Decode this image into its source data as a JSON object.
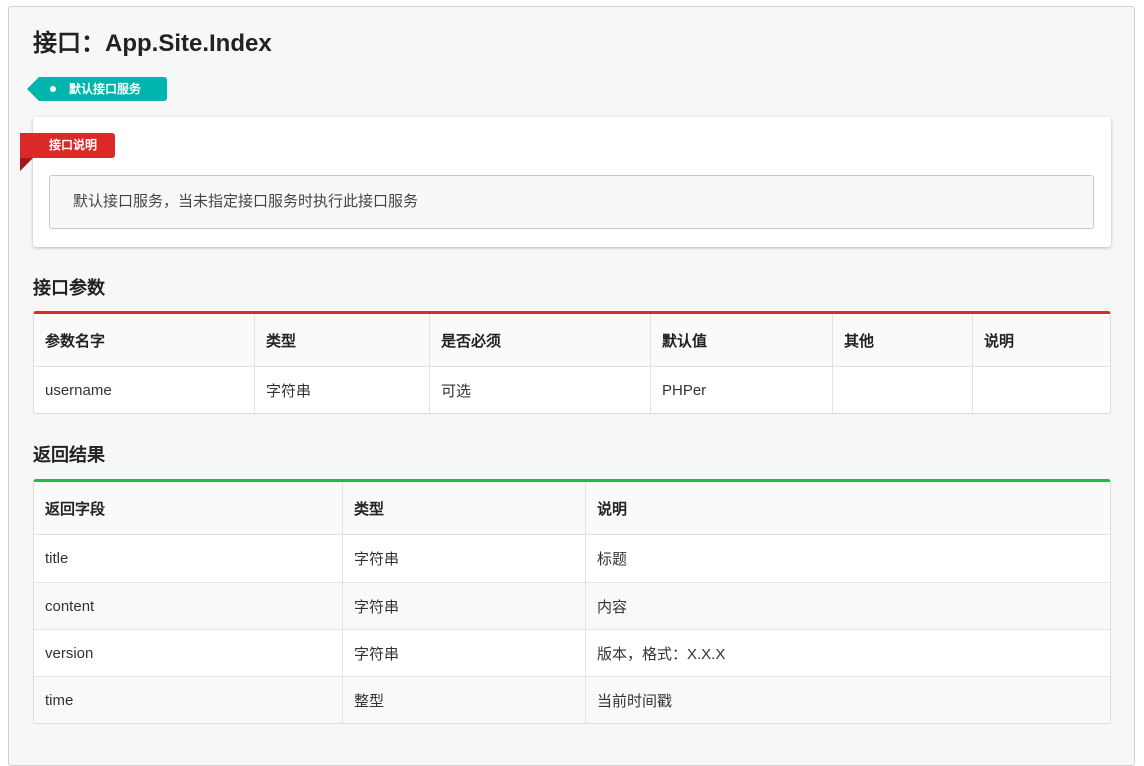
{
  "title": "接口：App.Site.Index",
  "tag": "默认接口服务",
  "ribbon": "接口说明",
  "description": "默认接口服务，当未指定接口服务时执行此接口服务",
  "params": {
    "heading": "接口参数",
    "headers": [
      "参数名字",
      "类型",
      "是否必须",
      "默认值",
      "其他",
      "说明"
    ],
    "rows": [
      [
        "username",
        "字符串",
        "可选",
        "PHPer",
        "",
        ""
      ]
    ]
  },
  "result": {
    "heading": "返回结果",
    "headers": [
      "返回字段",
      "类型",
      "说明"
    ],
    "rows": [
      [
        "title",
        "字符串",
        "标题"
      ],
      [
        "content",
        "字符串",
        "内容"
      ],
      [
        "version",
        "字符串",
        "版本，格式：X.X.X"
      ],
      [
        "time",
        "整型",
        "当前时间戳"
      ]
    ]
  }
}
